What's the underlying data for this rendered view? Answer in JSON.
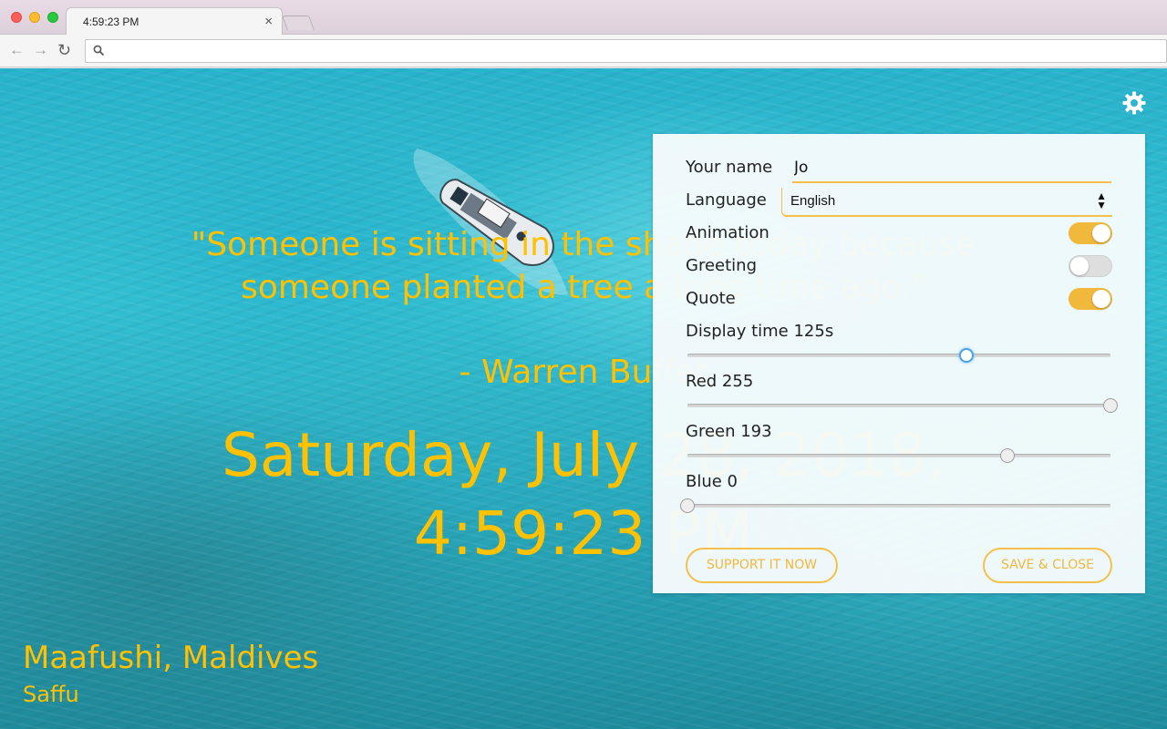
{
  "browser": {
    "tab_title": "4:59:23 PM",
    "tab_close": "×",
    "address": "",
    "back_icon": "arrow-left-icon",
    "forward_icon": "arrow-right-icon",
    "reload_icon": "reload-icon",
    "search_icon": "search-icon"
  },
  "page": {
    "quote": "\"Someone is sitting in the shade today because someone planted a tree a long time ago.\"",
    "quote_author": "- Warren Buffet",
    "date": "Saturday, July 28, 2018,",
    "time": "4:59:23 PM",
    "location": "Maafushi, Maldives",
    "photo_credit": "Saffu",
    "settings_icon": "gear-icon",
    "text_color": "#ffc100"
  },
  "settings": {
    "name_label": "Your name",
    "name_value": "Jo",
    "language_label": "Language",
    "language_value": "English",
    "animation_label": "Animation",
    "animation_on": true,
    "greeting_label": "Greeting",
    "greeting_on": false,
    "quote_label": "Quote",
    "quote_on": true,
    "display_time_label": "Display time 125s",
    "display_time_fraction": 0.66,
    "red_label": "Red 255",
    "red_value": 255,
    "green_label": "Green 193",
    "green_value": 193,
    "blue_label": "Blue 0",
    "blue_value": 0,
    "support_button": "SUPPORT IT NOW",
    "save_button": "SAVE & CLOSE",
    "accent_color": "#f0b93b"
  }
}
